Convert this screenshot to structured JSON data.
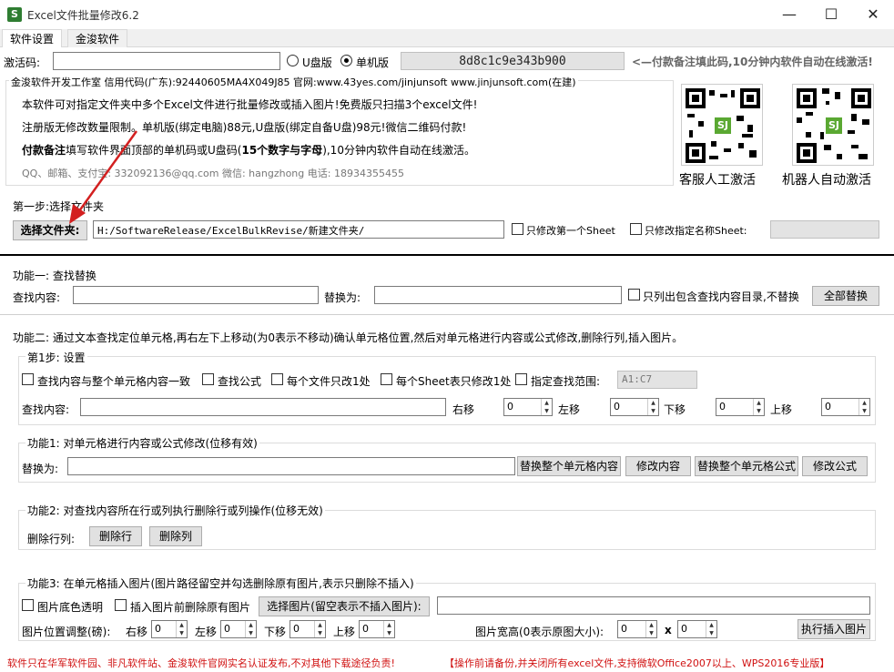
{
  "window": {
    "title": "Excel文件批量修改6.2",
    "minimize": "—",
    "maximize": "☐",
    "close": "✕"
  },
  "tabs": [
    {
      "label": "软件设置"
    },
    {
      "label": "金浚软件"
    }
  ],
  "activation": {
    "label": "激活码:",
    "value": "",
    "radio_udisk": "U盘版",
    "radio_single": "单机版",
    "selected": "单机版",
    "machine_code": "8d8c1c9e343b900",
    "hint": "<—付款备注填此码,10分钟内软件自动在线激活!"
  },
  "info": {
    "group_label": "金浚软件开发工作室 信用代码(广东):92440605MA4X049J85 官网:www.43yes.com/jinjunsoft  www.jinjunsoft.com(在建)",
    "line1": "本软件可对指定文件夹中多个Excel文件进行批量修改或插入图片!免费版只扫描3个excel文件!",
    "line2": "注册版无修改数量限制。单机版(绑定电脑)88元,U盘版(绑定自备U盘)98元!微信二维码付款!",
    "line3_bold": "付款备注",
    "line3": "填写软件界面顶部的单机码或U盘码(",
    "line3_bold2": "15个数字与字母",
    "line3_end": "),10分钟内软件自动在线激活。",
    "contact": "QQ、邮箱、支付宝: 332092136@qq.com   微信: hangzhong   电话: 18934355455",
    "qr1_caption": "客服人工激活",
    "qr2_caption": "机器人自动激活",
    "qr_logo": "SJ"
  },
  "step1": {
    "legend": "第一步:选择文件夹",
    "button": "选择文件夹:",
    "path": "H:/SoftwareRelease/ExcelBulkRevise/新建文件夹/",
    "chk_first_sheet": "只修改第一个Sheet",
    "chk_named_sheet": "只修改指定名称Sheet:",
    "sheet_name": ""
  },
  "func1": {
    "legend": "功能一: 查找替换",
    "find_label": "查找内容:",
    "find_value": "",
    "replace_label": "替换为:",
    "replace_value": "",
    "chk_list_only": "只列出包含查找内容目录,不替换",
    "replace_all": "全部替换"
  },
  "func2": {
    "legend": "功能二: 通过文本查找定位单元格,再右左下上移动(为0表示不移动)确认单元格位置,然后对单元格进行内容或公式修改,删除行列,插入图片。",
    "settings": {
      "legend": "第1步: 设置",
      "chk_exact": "查找内容与整个单元格内容一致",
      "chk_formula": "查找公式",
      "chk_once_file": "每个文件只改1处",
      "chk_once_sheet": "每个Sheet表只修改1处",
      "chk_range": "指定查找范围:",
      "range_value": "A1:C7",
      "find_label": "查找内容:",
      "find_value": "",
      "right_label": "右移",
      "right_value": "0",
      "left_label": "左移",
      "left_value": "0",
      "down_label": "下移",
      "down_value": "0",
      "up_label": "上移",
      "up_value": "0"
    },
    "modify": {
      "legend": "功能1: 对单元格进行内容或公式修改(位移有效)",
      "replace_label": "替换为:",
      "replace_value": "",
      "btn_replace_cell": "替换整个单元格内容",
      "btn_modify_content": "修改内容",
      "btn_replace_formula": "替换整个单元格公式",
      "btn_modify_formula": "修改公式"
    },
    "delete": {
      "legend": "功能2: 对查找内容所在行或列执行删除行或列操作(位移无效)",
      "label": "删除行列:",
      "btn_row": "删除行",
      "btn_col": "删除列"
    },
    "image": {
      "legend": "功能3: 在单元格插入图片(图片路径留空并勾选删除原有图片,表示只删除不插入)",
      "chk_transparent": "图片底色透明",
      "chk_delete_old": "插入图片前删除原有图片",
      "btn_choose": "选择图片(留空表示不插入图片):",
      "image_path": "",
      "pos_label": "图片位置调整(磅):",
      "right_label": "右移",
      "right_value": "0",
      "left_label": "左移",
      "left_value": "0",
      "down_label": "下移",
      "down_value": "0",
      "up_label": "上移",
      "up_value": "0",
      "size_label": "图片宽高(0表示原图大小):",
      "width_value": "0",
      "times": "x",
      "height_value": "0",
      "btn_insert": "执行插入图片"
    }
  },
  "footer": {
    "text1": "软件只在华军软件园、非凡软件站、金浚软件官网实名认证发布,不对其他下载途径负责!",
    "text2": "【操作前请备份,并关闭所有excel文件,支持微软Office2007以上、WPS2016专业版】"
  },
  "colors": {
    "accent_red": "#d01010",
    "arrow_red": "#d32020",
    "qr_green": "#5aa832"
  }
}
